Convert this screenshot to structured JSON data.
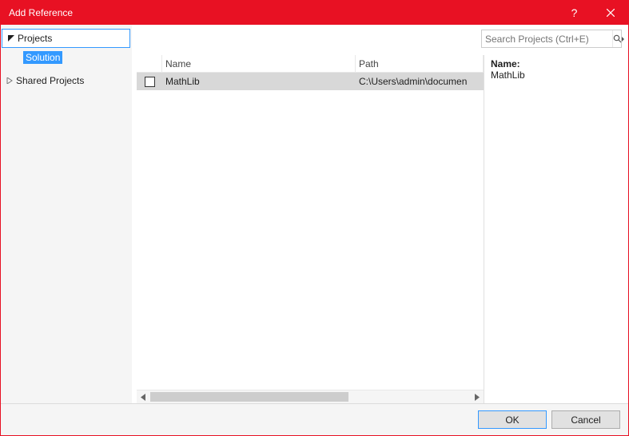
{
  "titlebar": {
    "title": "Add Reference"
  },
  "nav": {
    "projects_label": "Projects",
    "solution_label": "Solution",
    "shared_label": "Shared Projects"
  },
  "search": {
    "placeholder": "Search Projects (Ctrl+E)"
  },
  "list": {
    "headers": {
      "name": "Name",
      "path": "Path"
    },
    "rows": [
      {
        "name": "MathLib",
        "path": "C:\\Users\\admin\\documen"
      }
    ]
  },
  "details": {
    "name_label": "Name:",
    "name_value": "MathLib"
  },
  "footer": {
    "ok": "OK",
    "cancel": "Cancel"
  }
}
